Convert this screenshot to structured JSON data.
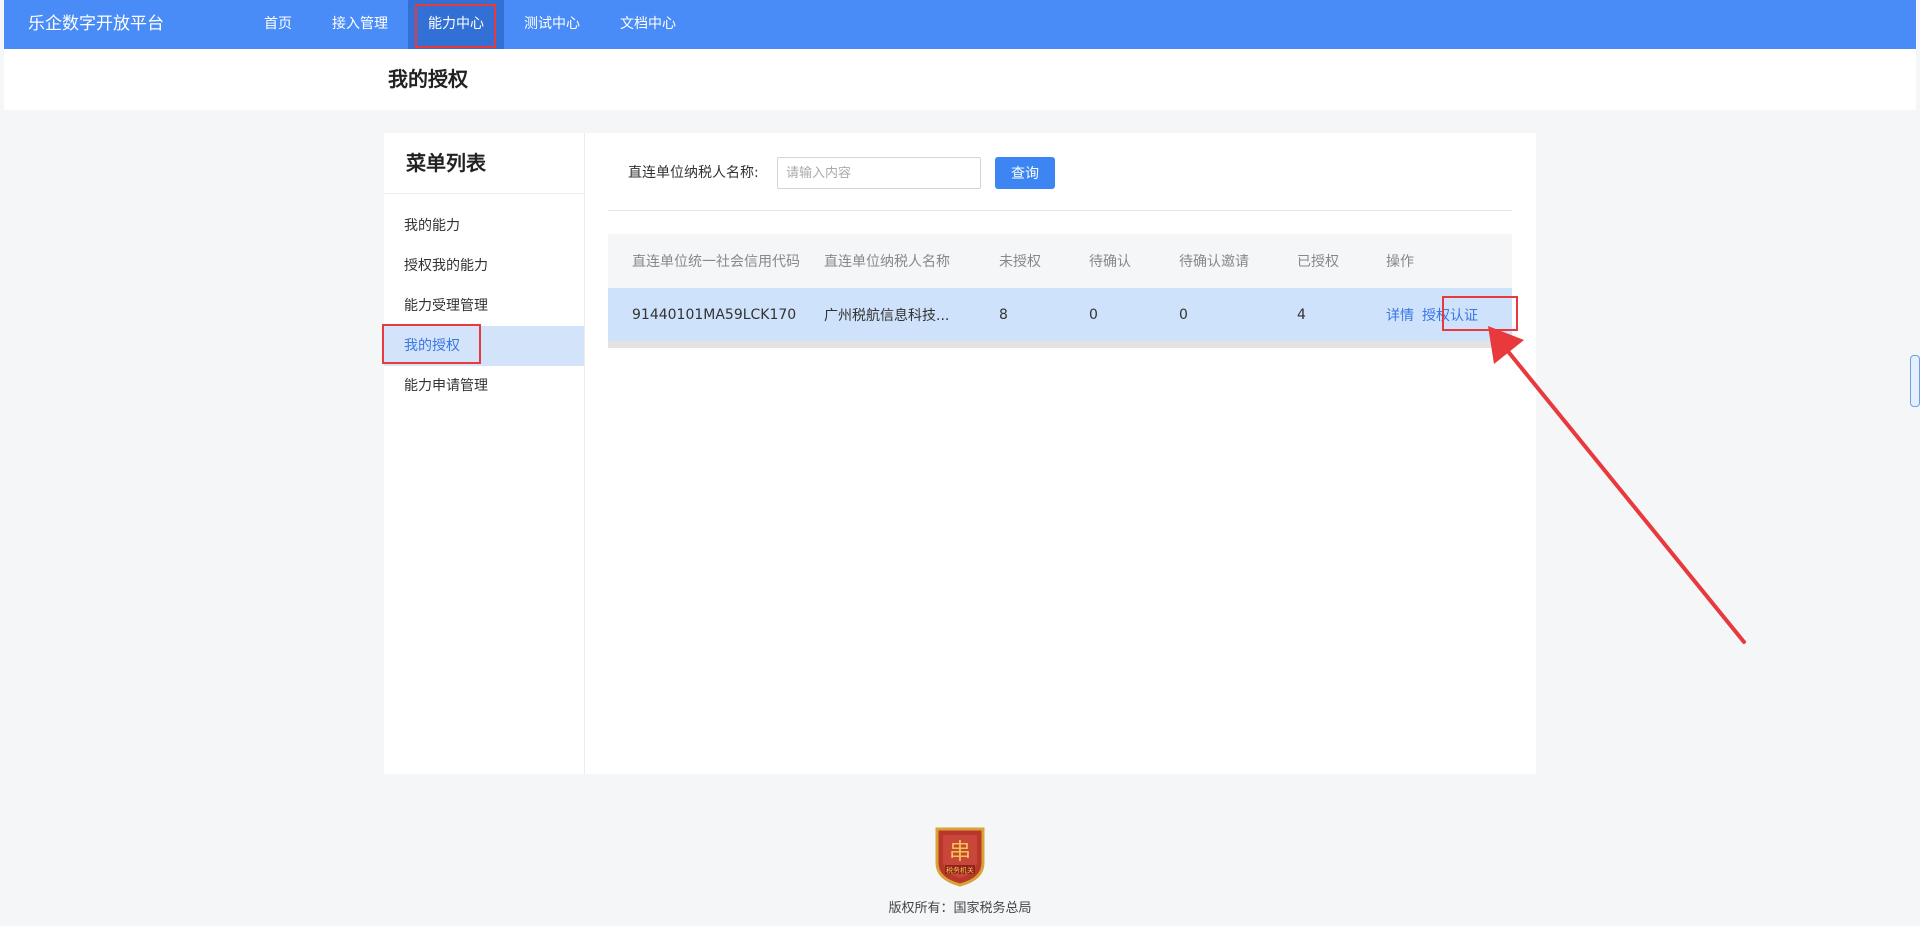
{
  "header": {
    "brand": "乐企数字开放平台",
    "nav": [
      {
        "label": "首页"
      },
      {
        "label": "接入管理"
      },
      {
        "label": "能力中心"
      },
      {
        "label": "测试中心"
      },
      {
        "label": "文档中心"
      }
    ],
    "active_index": 2
  },
  "page": {
    "title": "我的授权"
  },
  "sidebar": {
    "title": "菜单列表",
    "items": [
      {
        "label": "我的能力"
      },
      {
        "label": "授权我的能力"
      },
      {
        "label": "能力受理管理"
      },
      {
        "label": "我的授权"
      },
      {
        "label": "能力申请管理"
      }
    ],
    "active_index": 3
  },
  "filter": {
    "label": "直连单位纳税人名称:",
    "input_placeholder": "请输入内容",
    "input_value": "",
    "query_button": "查询"
  },
  "table": {
    "columns": [
      "直连单位统一社会信用代码",
      "直连单位纳税人名称",
      "未授权",
      "待确认",
      "待确认邀请",
      "已授权",
      "操作"
    ],
    "rows": [
      {
        "credit_code": "91440101MA59LCK170",
        "taxpayer_name": "广州税航信息科技...",
        "unauthorized": "8",
        "pending_confirm": "0",
        "pending_invite": "0",
        "authorized": "4",
        "actions": [
          "详情",
          "授权认证"
        ]
      }
    ]
  },
  "footer": {
    "copyright": "版权所有：国家税务总局",
    "logo_text": "税务机关"
  },
  "colors": {
    "nav_bg": "#4a8cf7",
    "nav_active": "#3270d6",
    "accent": "#3a78e6",
    "row_highlight": "#cfe2fb",
    "annotation": "#e8393c"
  }
}
